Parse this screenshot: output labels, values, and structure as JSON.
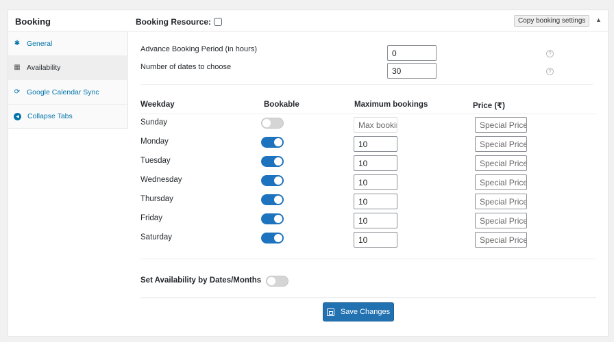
{
  "panel": {
    "title": "Booking",
    "resource_label": "Booking Resource:",
    "copy_button": "Copy booking settings",
    "collapse_glyph": "▲"
  },
  "tabs": [
    {
      "label": "General",
      "icon": "gear-icon",
      "glyph": "✱",
      "active": false
    },
    {
      "label": "Availability",
      "icon": "calendar-icon",
      "glyph": "▦",
      "active": true
    },
    {
      "label": "Google Calendar Sync",
      "icon": "sync-icon",
      "glyph": "⟳",
      "active": false
    },
    {
      "label": "Collapse Tabs",
      "icon": "collapse-left-icon",
      "glyph": "◀",
      "active": false
    }
  ],
  "settings": {
    "advance_label": "Advance Booking Period (in hours)",
    "advance_value": "0",
    "dates_label": "Number of dates to choose",
    "dates_value": "30",
    "help_glyph": "?"
  },
  "table": {
    "headers": {
      "weekday": "Weekday",
      "bookable": "Bookable",
      "max": "Maximum bookings",
      "price": "Price (₹)"
    },
    "max_placeholder": "Max bookings",
    "price_placeholder": "Special Price",
    "rows": [
      {
        "day": "Sunday",
        "bookable": false,
        "max": ""
      },
      {
        "day": "Monday",
        "bookable": true,
        "max": "10"
      },
      {
        "day": "Tuesday",
        "bookable": true,
        "max": "10"
      },
      {
        "day": "Wednesday",
        "bookable": true,
        "max": "10"
      },
      {
        "day": "Thursday",
        "bookable": true,
        "max": "10"
      },
      {
        "day": "Friday",
        "bookable": true,
        "max": "10"
      },
      {
        "day": "Saturday",
        "bookable": true,
        "max": "10"
      }
    ]
  },
  "dates_months": {
    "label": "Set Availability by Dates/Months",
    "enabled": false
  },
  "save_button": "Save Changes",
  "colors": {
    "accent": "#2271b1",
    "toggle_on": "#1e73be",
    "toggle_off": "#d5d5d5",
    "link": "#0073aa"
  }
}
